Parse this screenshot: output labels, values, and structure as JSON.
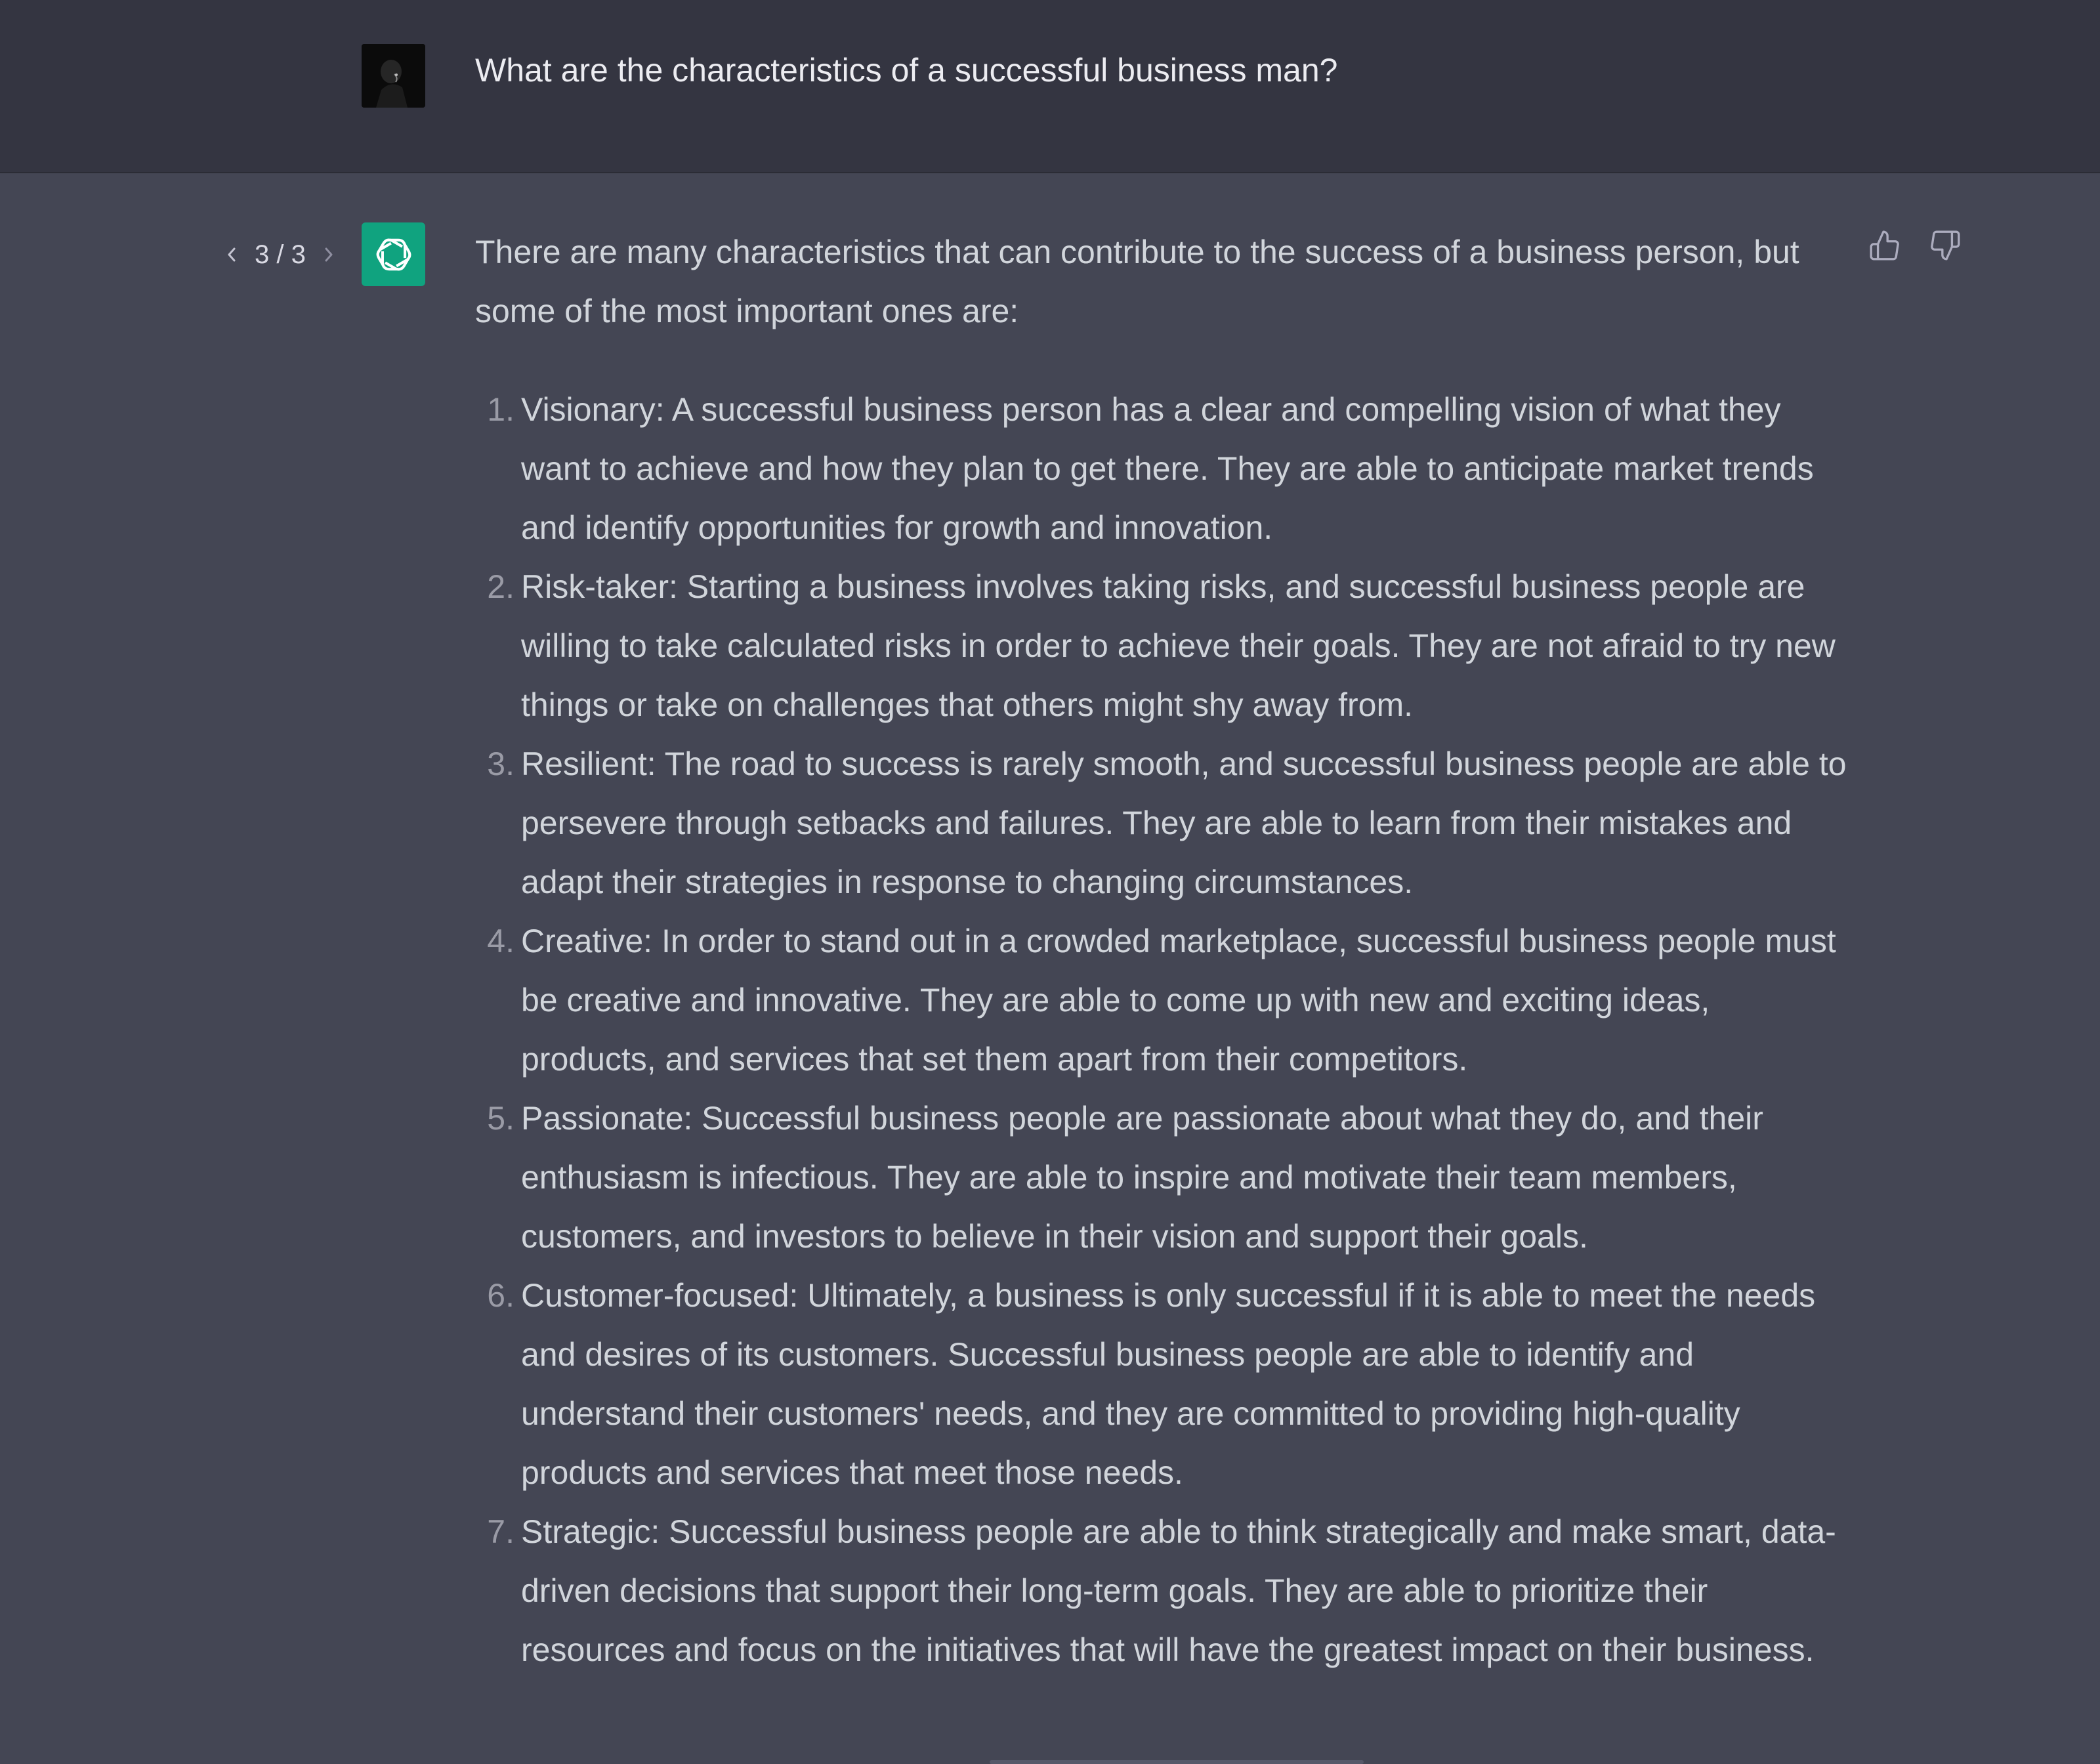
{
  "user_message": {
    "text": "What are the characteristics of a successful business man?"
  },
  "assistant_message": {
    "pager": "3 / 3",
    "intro": "There are many characteristics that can contribute to the success of a business person, but some of the most important ones are:",
    "items": [
      {
        "number": "1.",
        "text": "Visionary: A successful business person has a clear and compelling vision of what they want to achieve and how they plan to get there. They are able to anticipate market trends and identify opportunities for growth and innovation."
      },
      {
        "number": "2.",
        "text": "Risk-taker: Starting a business involves taking risks, and successful business people are willing to take calculated risks in order to achieve their goals. They are not afraid to try new things or take on challenges that others might shy away from."
      },
      {
        "number": "3.",
        "text": "Resilient: The road to success is rarely smooth, and successful business people are able to persevere through setbacks and failures. They are able to learn from their mistakes and adapt their strategies in response to changing circumstances."
      },
      {
        "number": "4.",
        "text": "Creative: In order to stand out in a crowded marketplace, successful business people must be creative and innovative. They are able to come up with new and exciting ideas, products, and services that set them apart from their competitors."
      },
      {
        "number": "5.",
        "text": "Passionate: Successful business people are passionate about what they do, and their enthusiasm is infectious. They are able to inspire and motivate their team members, customers, and investors to believe in their vision and support their goals."
      },
      {
        "number": "6.",
        "text": "Customer-focused: Ultimately, a business is only successful if it is able to meet the needs and desires of its customers. Successful business people are able to identify and understand their customers' needs, and they are committed to providing high-quality products and services that meet those needs."
      },
      {
        "number": "7.",
        "text": "Strategic: Successful business people are able to think strategically and make smart, data-driven decisions that support their long-term goals. They are able to prioritize their resources and focus on the initiatives that will have the greatest impact on their business."
      }
    ]
  },
  "icons": {
    "prev": "chevron-left-icon",
    "next": "chevron-right-icon",
    "bot": "openai-logo-icon",
    "thumbs_up": "thumbs-up-icon",
    "thumbs_down": "thumbs-down-icon"
  },
  "colors": {
    "user_bg": "#343541",
    "assistant_bg": "#444654",
    "bot_avatar": "#10a37f",
    "text": "#d1d5db"
  }
}
